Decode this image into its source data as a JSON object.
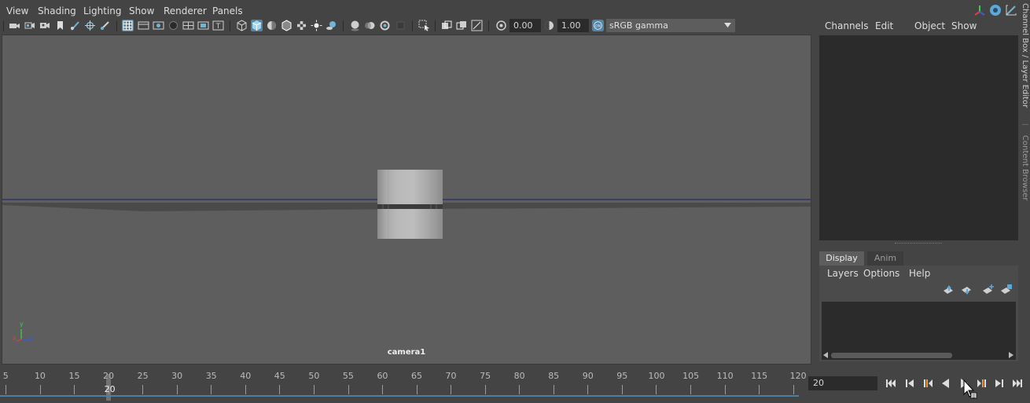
{
  "viewport_menu": [
    "View",
    "Shading",
    "Lighting",
    "Show",
    "Renderer",
    "Panels"
  ],
  "toolbar": {
    "exposure_value": "0.00",
    "gamma_value": "1.00",
    "color_space": "sRGB gamma"
  },
  "viewport": {
    "camera_label": "camera1",
    "axis_labels": {
      "x": "x",
      "y": "y",
      "z": "z"
    }
  },
  "channel_box": {
    "menu": [
      "Channels",
      "Edit",
      "Object",
      "Show"
    ]
  },
  "layer_editor": {
    "tabs": [
      "Display",
      "Anim"
    ],
    "active_tab": "Display",
    "menu": [
      "Layers",
      "Options",
      "Help"
    ]
  },
  "side_tabs": [
    "Channel Box / Layer Editor",
    "Content Browser"
  ],
  "time_slider": {
    "ticks": [
      5,
      10,
      15,
      20,
      25,
      30,
      35,
      40,
      45,
      50,
      55,
      60,
      65,
      70,
      75,
      80,
      85,
      90,
      95,
      100,
      105,
      110,
      115,
      120
    ],
    "current_frame": "20",
    "current_frame_field": "20"
  },
  "colors": {
    "accent": "#5285a6",
    "viewport_bg": "#5e5e5e",
    "horizon_line": "#1b1f6e",
    "timeline_bar": "#4d7fa3"
  }
}
